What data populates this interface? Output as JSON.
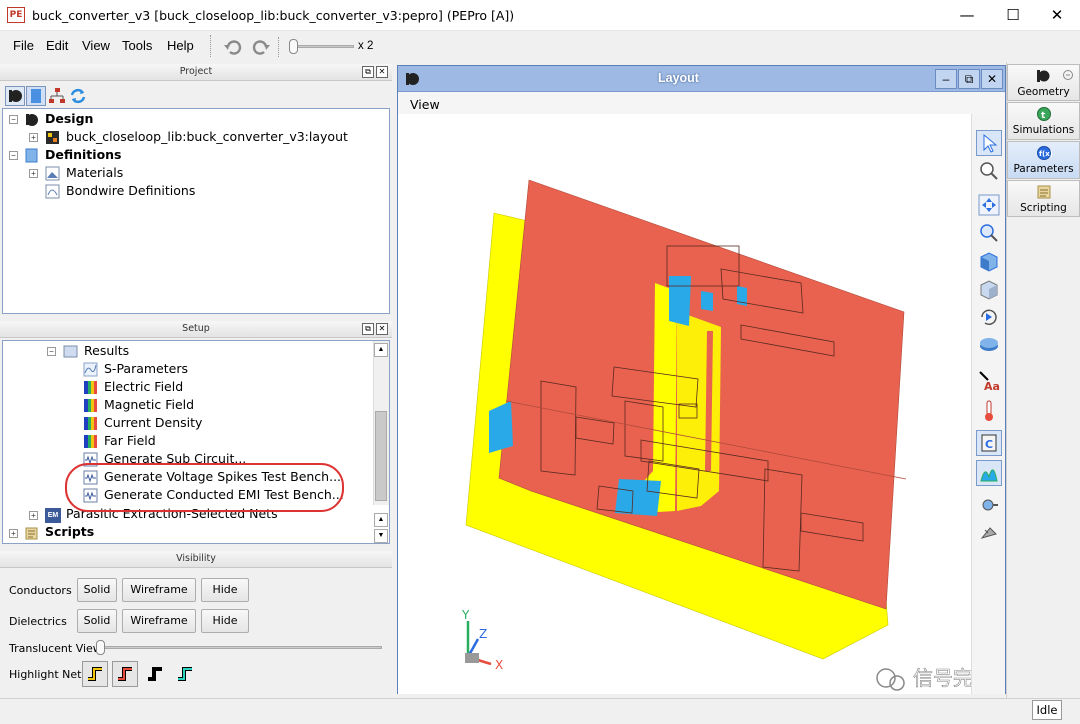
{
  "window": {
    "title": "buck_converter_v3 [buck_closeloop_lib:buck_converter_v3:pepro] (PEPro [A])",
    "app_icon_text": "PE",
    "minimize": "—",
    "maximize": "☐",
    "close": "✕"
  },
  "menu": {
    "items": [
      "File",
      "Edit",
      "View",
      "Tools",
      "Help"
    ],
    "zoom_label": "x 2"
  },
  "project": {
    "header": "Project",
    "tree": {
      "design": "Design",
      "layout_item": "buck_closeloop_lib:buck_converter_v3:layout",
      "definitions": "Definitions",
      "materials": "Materials",
      "bondwire": "Bondwire Definitions"
    }
  },
  "setup": {
    "header": "Setup",
    "results": "Results",
    "items": [
      "S-Parameters",
      "Electric Field",
      "Magnetic Field",
      "Current Density",
      "Far Field",
      "Generate Sub Circuit...",
      "Generate Voltage Spikes Test Bench...",
      "Generate Conducted EMI Test Bench..."
    ],
    "parasitic": "Parasitic Extraction-Selected Nets",
    "scripts": "Scripts",
    "em_badge": "EM"
  },
  "visibility": {
    "header": "Visibility",
    "conductors_label": "Conductors",
    "dielectrics_label": "Dielectrics",
    "solid": "Solid",
    "wireframe": "Wireframe",
    "hide": "Hide",
    "translucent_label": "Translucent View:",
    "highlight_label": "Highlight Nets:"
  },
  "layout": {
    "title": "Layout",
    "view_menu": "View",
    "axis_x": "X",
    "axis_y": "Y",
    "axis_z": "Z",
    "colors": {
      "plane": "#e8624f",
      "dielectric": "#ffff00",
      "trace": "#2aa9e8"
    }
  },
  "dock": {
    "geometry": "Geometry",
    "simulations": "Simulations",
    "parameters": "Parameters",
    "scripting": "Scripting"
  },
  "watermark": "信号完整性",
  "status": {
    "idle": "Idle"
  }
}
